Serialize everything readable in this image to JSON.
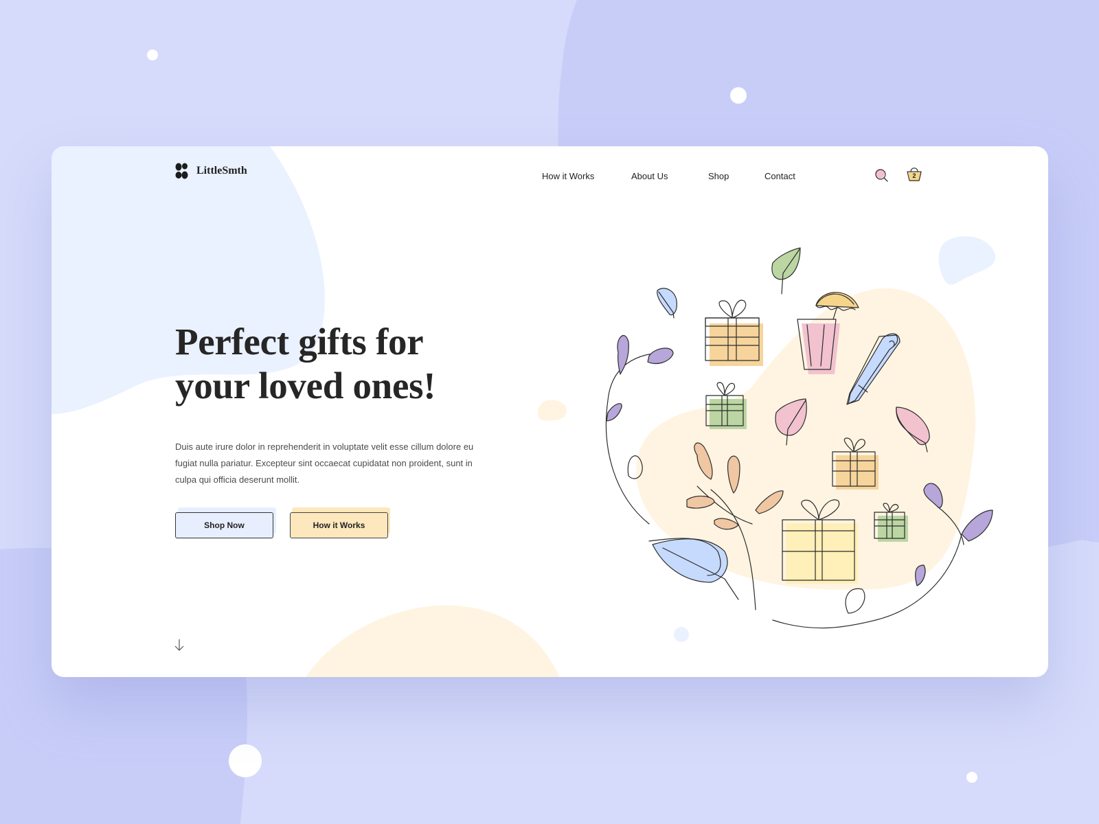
{
  "brand": {
    "name": "LittleSmth"
  },
  "nav": {
    "items": [
      {
        "label": "How it Works"
      },
      {
        "label": "About Us"
      },
      {
        "label": "Shop"
      },
      {
        "label": "Contact"
      }
    ]
  },
  "cart": {
    "count": "2"
  },
  "hero": {
    "title_line1": "Perfect gifts for",
    "title_line2": "your loved ones!",
    "description": "Duis aute irure dolor in reprehenderit in voluptate velit esse cillum dolore eu fugiat nulla pariatur. Excepteur sint occaecat cupidatat non proident, sunt in culpa qui officia deserunt mollit.",
    "primary_button": "Shop Now",
    "secondary_button": "How it Works"
  },
  "icons": {
    "search": "search-icon",
    "cart": "shopping-basket-icon",
    "scroll": "arrow-down-icon",
    "logo": "logo-mark-icon"
  },
  "colors": {
    "page_background": "#d6dbfb",
    "blob_blue": "#c8cdf8",
    "card_blob_blue": "#eaf1ff",
    "card_blob_peach": "#fff4e1",
    "primary_button_fill": "#e7efff",
    "secondary_button_fill": "#fde7bd",
    "text_dark": "#262626"
  }
}
